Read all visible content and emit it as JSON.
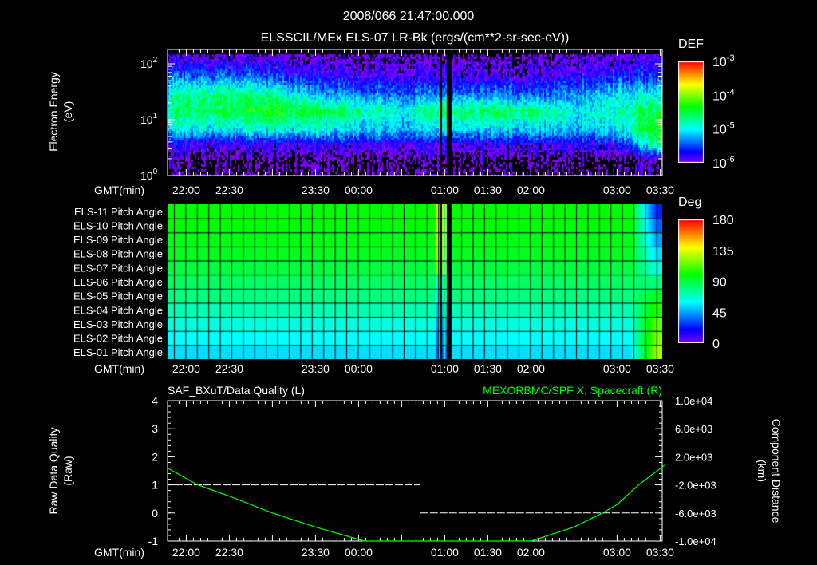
{
  "header": {
    "timestamp": "2008/066 21:47:00.000",
    "subtitle": "ELSSCIL/MEx ELS-07 LR-Bk  (ergs/(cm**2-sr-sec-eV))"
  },
  "time_axis": {
    "label": "GMT(min)",
    "ticks": [
      "22:00",
      "22:30",
      "23:30",
      "00:00",
      "01:00",
      "01:30",
      "02:00",
      "03:00",
      "03:30"
    ],
    "tick_minutes": [
      13,
      43,
      103,
      133,
      193,
      223,
      253,
      313,
      343
    ],
    "start": "21:47",
    "end": "03:33"
  },
  "chart_data": [
    {
      "type": "heatmap",
      "title": "ELSSCIL/MEx ELS-07 LR-Bk",
      "ylabel": "Electron Energy (eV)",
      "ylabel_lines": [
        "Electron Energy",
        "(eV)"
      ],
      "yscale": "log",
      "ylim": [
        1,
        186
      ],
      "yticks": [
        "10^0",
        "10^1",
        "10^2"
      ],
      "colorbar": {
        "label": "DEF",
        "scale": "log",
        "range": [
          -6,
          -3
        ],
        "ticks": [
          "10^-3",
          "10^-4",
          "10^-5",
          "10^-6"
        ]
      },
      "times_min": [
        0,
        13,
        43,
        73,
        103,
        133,
        163,
        193,
        223,
        253,
        283,
        313,
        343
      ],
      "energies": [
        2,
        4,
        7,
        15,
        30,
        70,
        150
      ],
      "log_def": [
        [
          -6.2,
          -6.2,
          -6.2,
          -6.2,
          -6.2,
          -6.2,
          -6.2,
          -6.2,
          -6.2,
          -6.2,
          -6.2,
          -6.2,
          -6.1
        ],
        [
          -5.8,
          -5.8,
          -5.8,
          -5.8,
          -5.8,
          -5.8,
          -5.8,
          -5.8,
          -5.8,
          -5.8,
          -5.8,
          -5.7,
          -4.5
        ],
        [
          -5.1,
          -5.0,
          -5.0,
          -4.9,
          -5.0,
          -5.1,
          -5.2,
          -5.1,
          -5.1,
          -5.1,
          -5.2,
          -5.0,
          -4.3
        ],
        [
          -4.8,
          -4.6,
          -4.5,
          -4.3,
          -4.5,
          -4.7,
          -4.9,
          -4.6,
          -4.5,
          -4.6,
          -5.0,
          -4.8,
          -4.4
        ],
        [
          -5.0,
          -4.7,
          -4.6,
          -4.7,
          -5.2,
          -5.3,
          -5.4,
          -5.3,
          -5.3,
          -5.4,
          -5.3,
          -5.0,
          -5.0
        ],
        [
          -5.5,
          -5.5,
          -5.4,
          -5.6,
          -5.8,
          -5.9,
          -5.9,
          -5.9,
          -5.9,
          -5.9,
          -5.8,
          -5.6,
          -5.6
        ],
        [
          -6.0,
          -6.0,
          -6.0,
          -6.0,
          -6.1,
          -6.1,
          -6.1,
          -6.1,
          -6.1,
          -6.1,
          -6.1,
          -6.0,
          -6.0
        ]
      ],
      "data_gaps_min": [
        [
          189,
          190
        ],
        [
          194,
          197
        ]
      ]
    },
    {
      "type": "heatmap",
      "title": "Pitch Angle",
      "colorbar": {
        "label": "Deg",
        "range": [
          0,
          180
        ],
        "ticks": [
          "180",
          "135",
          "90",
          "45",
          "0"
        ]
      },
      "rows": [
        {
          "label": "ELS-11 Pitch Angle",
          "value": 100,
          "end_value": 25
        },
        {
          "label": "ELS-10 Pitch Angle",
          "value": 100,
          "end_value": 35
        },
        {
          "label": "ELS-09 Pitch Angle",
          "value": 97,
          "end_value": 45
        },
        {
          "label": "ELS-08 Pitch Angle",
          "value": 95,
          "end_value": 55
        },
        {
          "label": "ELS-07 Pitch Angle",
          "value": 90,
          "end_value": 65
        },
        {
          "label": "ELS-06 Pitch Angle",
          "value": 85,
          "end_value": 80
        },
        {
          "label": "ELS-05 Pitch Angle",
          "value": 80,
          "end_value": 95
        },
        {
          "label": "ELS-04 Pitch Angle",
          "value": 72,
          "end_value": 105
        },
        {
          "label": "ELS-03 Pitch Angle",
          "value": 65,
          "end_value": 115
        },
        {
          "label": "ELS-02 Pitch Angle",
          "value": 60,
          "end_value": 120
        },
        {
          "label": "ELS-01 Pitch Angle",
          "value": 55,
          "end_value": 125
        }
      ],
      "transition_min": [
        322,
        340
      ],
      "disturbed_min": [
        186,
        197
      ],
      "data_gaps_min": [
        [
          189,
          190
        ],
        [
          194,
          197
        ]
      ]
    },
    {
      "type": "line",
      "left_title": "SAF_BXuT/Data Quality (L)",
      "right_title": "MEXORBMC/SPF X, Spacecraft (R)",
      "ylabel_left_lines": [
        "Raw Data Quality",
        "(Raw)"
      ],
      "ylabel_right_lines": [
        "Component Distance",
        "(km)"
      ],
      "ylim_left": [
        -1,
        4
      ],
      "ylim_right": [
        -10000,
        10000
      ],
      "yticks_left": [
        "4",
        "3",
        "2",
        "1",
        "0",
        "-1"
      ],
      "yticks_right": [
        "1.0e+04",
        "6.0e+03",
        "2.0e+03",
        "-2.0e+03",
        "-6.0e+03",
        "-1.0e+04"
      ],
      "series": [
        {
          "name": "Data Quality",
          "color": "#ffffff",
          "style": "dashed",
          "segments": [
            {
              "x": [
                5,
                176
              ],
              "y": [
                1,
                1
              ]
            },
            {
              "x": [
                176,
                338
              ],
              "y": [
                0,
                0
              ]
            }
          ]
        },
        {
          "name": "SPF X",
          "color": "#00ff00",
          "axis": "right",
          "x": [
            0,
            21,
            43,
            73,
            103,
            137,
            253,
            283,
            303,
            313,
            328,
            346
          ],
          "y": [
            400,
            -2000,
            -3600,
            -6000,
            -8000,
            -10000,
            -10000,
            -8000,
            -6000,
            -4800,
            -2000,
            800
          ]
        }
      ]
    }
  ],
  "colors": {
    "background": "#000000",
    "axis": "#ffffff",
    "spf_line": "#00ff00"
  }
}
